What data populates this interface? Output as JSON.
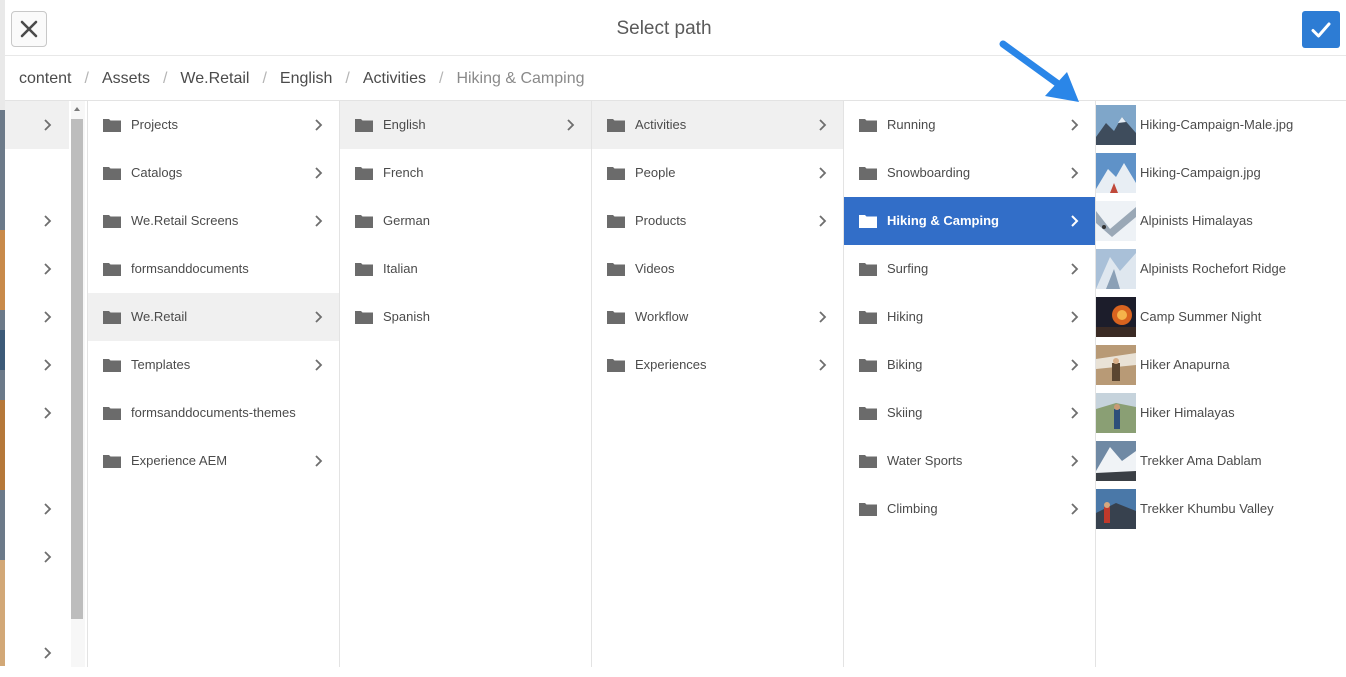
{
  "dialog": {
    "title": "Select path",
    "close_icon": "close-icon",
    "confirm_icon": "checkmark-icon",
    "confirm_color": "#2d7cd4"
  },
  "breadcrumb": [
    "content",
    "Assets",
    "We.Retail",
    "English",
    "Activities",
    "Hiking & Camping"
  ],
  "columns": {
    "col1": [
      "Projects",
      "Catalogs",
      "We.Retail Screens",
      "formsanddocuments",
      "We.Retail",
      "Templates",
      "formsanddocuments-themes",
      "Experience AEM"
    ],
    "col2": [
      "English",
      "French",
      "German",
      "Italian",
      "Spanish"
    ],
    "col3": [
      "Activities",
      "People",
      "Products",
      "Videos",
      "Workflow",
      "Experiences"
    ],
    "col4": [
      "Running",
      "Snowboarding",
      "Hiking & Camping",
      "Surfing",
      "Hiking",
      "Biking",
      "Skiing",
      "Water Sports",
      "Climbing"
    ],
    "assets": [
      "Hiking-Campaign-Male.jpg",
      "Hiking-Campaign.jpg",
      "Alpinists Himalayas",
      "Alpinists Rochefort Ridge",
      "Camp Summer Night",
      "Hiker Anapurna",
      "Hiker Himalayas",
      "Trekker Ama Dablam",
      "Trekker Khumbu Valley"
    ]
  },
  "colors": {
    "selected_row": "#326ec8",
    "active_row": "#f0f0f0",
    "annotation_arrow": "#2a86e8"
  }
}
